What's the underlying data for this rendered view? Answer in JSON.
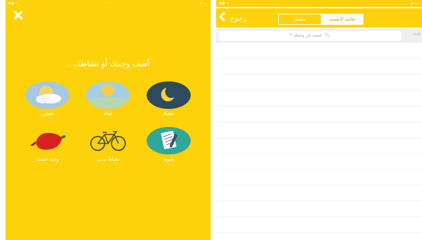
{
  "colors": {
    "accent": "#fdd20a",
    "white": "#ffffff",
    "search_bg": "#efefef"
  },
  "left_screen": {
    "close_icon": "close-icon",
    "prompt": "أضف وجبتك أو نشاطك ..",
    "items": [
      {
        "label": "فطور",
        "icon": "cloud-sun-icon"
      },
      {
        "label": "غداء",
        "icon": "sun-icon"
      },
      {
        "label": "عشاء",
        "icon": "moon-icon"
      },
      {
        "label": "وجبة خفيفة",
        "icon": "pepper-icon"
      },
      {
        "label": "نشاط بدني",
        "icon": "bicycle-icon"
      },
      {
        "label": "شوية",
        "icon": "notepad-icon"
      }
    ]
  },
  "right_screen": {
    "back_label": "رجوع",
    "tabs": [
      {
        "label": "مفضلة",
        "active": false
      },
      {
        "label": "قائمة الأطعمة",
        "active": true
      }
    ],
    "search_placeholder": "ابحث عن وجبتك ؟",
    "cancel_label": "إلغاء"
  }
}
